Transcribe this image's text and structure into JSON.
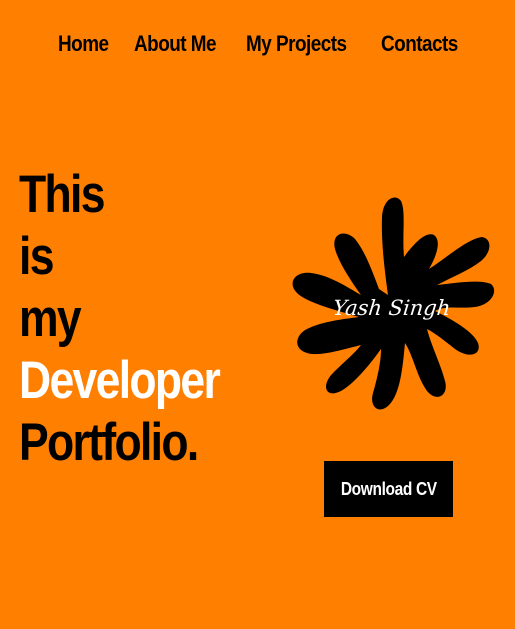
{
  "nav": {
    "items": [
      {
        "label": "Home"
      },
      {
        "label": "About Me"
      },
      {
        "label": "My Projects"
      },
      {
        "label": "Contacts"
      }
    ]
  },
  "hero": {
    "lines": [
      "This",
      "is",
      "my",
      "Developer",
      "Portfolio."
    ],
    "highlight_word": "Developer"
  },
  "splat": {
    "signature": "Yash Singh"
  },
  "actions": {
    "download_cv_label": "Download CV"
  },
  "colors": {
    "background": "#ff7f00",
    "text": "#000000",
    "highlight": "#ffffff",
    "button_bg": "#000000",
    "button_text": "#ffffff"
  }
}
